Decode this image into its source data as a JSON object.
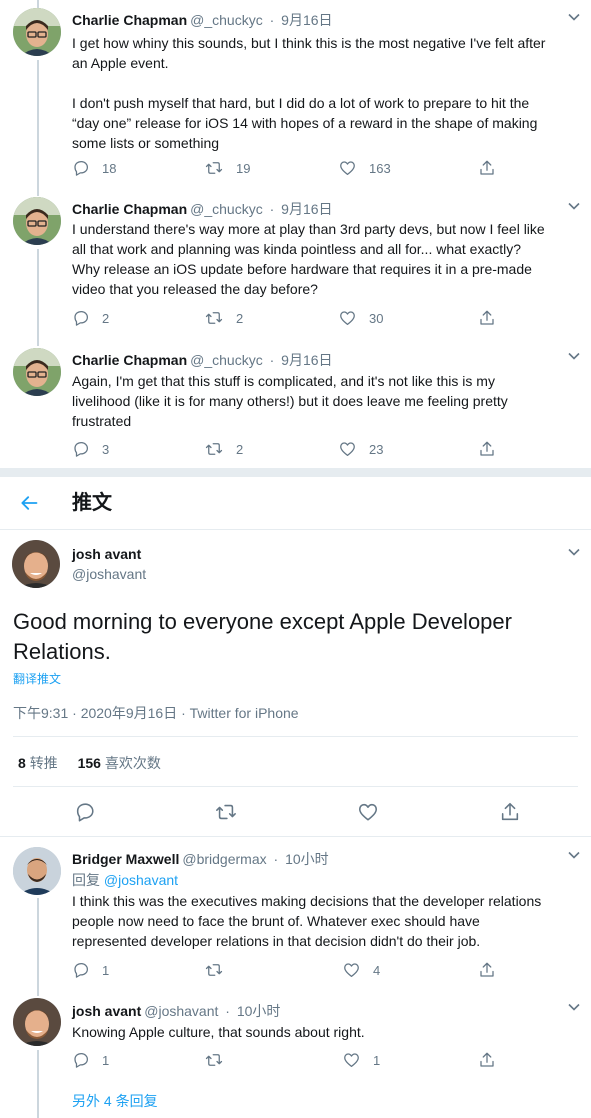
{
  "thread_tweets": [
    {
      "name": "Charlie Chapman",
      "handle": "@_chuckyc",
      "date": "9月16日",
      "lines": [
        "I get how whiny this sounds, but I think this is the most negative I've felt after",
        "an Apple event.",
        "",
        "I don't push myself that hard, but I did do a lot of work to prepare to hit the",
        "“day one” release for iOS 14 with hopes of a reward in the shape of making",
        "some lists or something"
      ],
      "replies": "18",
      "retweets": "19",
      "likes": "163"
    },
    {
      "name": "Charlie Chapman",
      "handle": "@_chuckyc",
      "date": "9月16日",
      "lines": [
        "I understand there's way more at play than 3rd party devs, but now I feel like",
        "all that work and planning was kinda pointless and all for... what exactly?",
        "Why release an iOS update before hardware that requires it in a pre-made",
        "video that you released the day before?"
      ],
      "replies": "2",
      "retweets": "2",
      "likes": "30"
    },
    {
      "name": "Charlie Chapman",
      "handle": "@_chuckyc",
      "date": "9月16日",
      "lines": [
        "Again, I'm get that this stuff is complicated, and it's not like this is my",
        "livelihood (like it is for many others!) but it does leave me feeling pretty",
        "frustrated"
      ],
      "replies": "3",
      "retweets": "2",
      "likes": "23"
    }
  ],
  "header": {
    "title": "推文"
  },
  "main_tweet": {
    "name": "josh avant",
    "handle": "@joshavant",
    "text_lines": [
      "Good morning to everyone except Apple Developer",
      "Relations."
    ],
    "translate_label": "翻译推文",
    "timestamp": "下午9:31 · 2020年9月16日 · Twitter for iPhone",
    "retweet_count": "8",
    "retweet_label": "转推",
    "like_count": "156",
    "like_label": "喜欢次数"
  },
  "replies": [
    {
      "name": "Bridger Maxwell",
      "handle": "@bridgermax",
      "time": "10小时",
      "reply_to_prefix": "回复",
      "reply_to_handle": "@joshavant",
      "lines": [
        "I think this was the executives making decisions that the developer relations",
        "people now need to face the brunt of. Whatever exec should have",
        "represented developer relations in that decision didn't do their job."
      ],
      "replies": "1",
      "retweets": "",
      "likes": "4"
    },
    {
      "name": "josh avant",
      "handle": "@joshavant",
      "time": "10小时",
      "lines": [
        "Knowing Apple culture, that sounds about right."
      ],
      "replies": "1",
      "retweets": "",
      "likes": "1"
    }
  ],
  "more_replies_label": "另外 4 条回复",
  "colors": {
    "accent": "#1da1f2",
    "text": "#14171a",
    "secondary": "#657786",
    "divider": "#e6ecf0"
  }
}
